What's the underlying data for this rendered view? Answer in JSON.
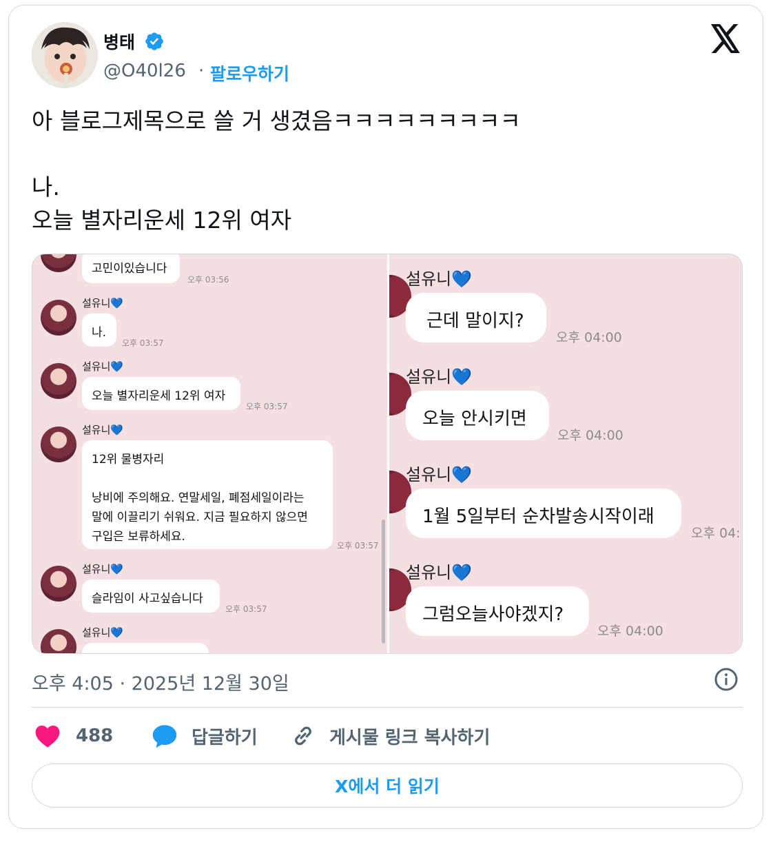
{
  "author": {
    "name": "병태",
    "handle": "@O40l26",
    "separator": "·",
    "follow_label": "팔로우하기"
  },
  "tweet": {
    "text": "아 블로그제목으로 쓸 거 생겼음ㅋㅋㅋㅋㅋㅋㅋㅋㅋ\n\n나.\n오늘 별자리운세 12위 여자",
    "timestamp": "오후 4:05 · 2025년 12월 30일"
  },
  "media": {
    "left_panel": {
      "messages": [
        {
          "sender": "",
          "text": "고민이있습니다",
          "time": "오후 03:56"
        },
        {
          "sender": "설유니",
          "text": "나.",
          "time": "오후 03:57"
        },
        {
          "sender": "설유니",
          "text": "오늘 별자리운세 12위 여자",
          "time": "오후 03:57"
        },
        {
          "sender": "설유니",
          "lines": [
            "12위 물병자리",
            "낭비에 주의해요. 연말세일, 폐점세일이라는",
            "말에 이끌리기 쉬워요. 지금 필요하지 않으면",
            "구입은 보류하세요."
          ],
          "time": "오후 03:57"
        },
        {
          "sender": "설유니",
          "text": "슬라임이 사고싶습니다",
          "time": "오후 03:57"
        },
        {
          "sender": "설유니",
          "text": "",
          "time": ""
        }
      ]
    },
    "right_panel": {
      "messages": [
        {
          "sender": "설유니",
          "text": "근데 말이지?",
          "time": "오후 04:00"
        },
        {
          "sender": "설유니",
          "text": "오늘 안시키면",
          "time": "오후 04:00"
        },
        {
          "sender": "설유니",
          "text": "1월 5일부터 순차발송시작이래",
          "time": "오후 04:"
        },
        {
          "sender": "설유니",
          "text": "그럼오늘사야겠지?",
          "time": "오후 04:00"
        }
      ]
    },
    "heart_emoji": "💙"
  },
  "actions": {
    "like_count": "488",
    "reply_label": "답글하기",
    "copy_link_label": "게시물 링크 복사하기",
    "read_more_label": "X에서 더 읽기"
  },
  "colors": {
    "accent": "#1d9bf0",
    "like": "#f91880",
    "chat_background": "#f4dfe3",
    "secondary_text": "#536471"
  },
  "icons": [
    "verified-badge-icon",
    "x-logo-icon",
    "info-icon",
    "heart-icon",
    "reply-bubble-icon",
    "link-icon"
  ]
}
